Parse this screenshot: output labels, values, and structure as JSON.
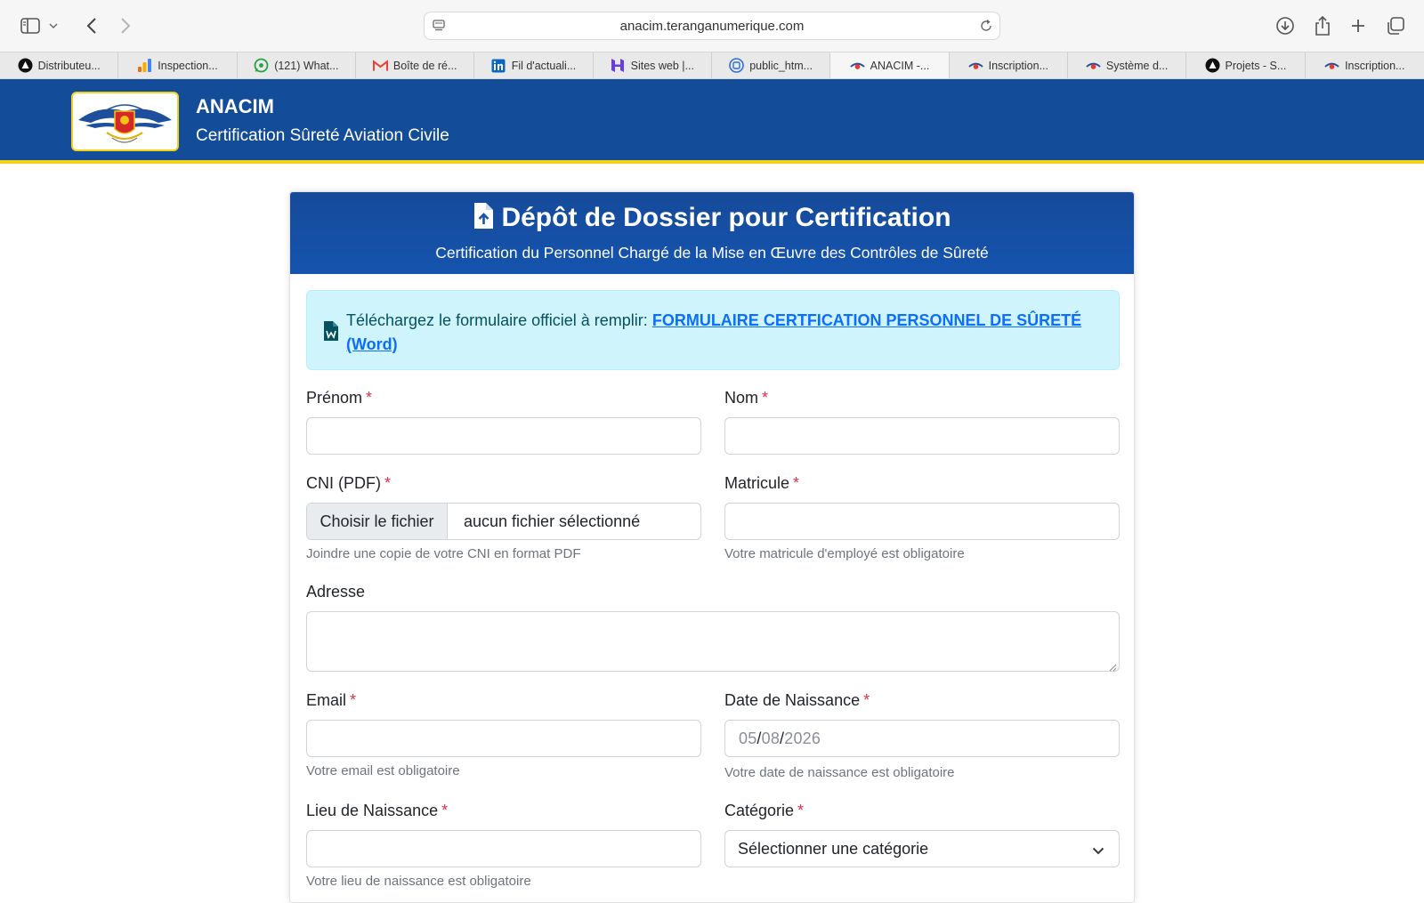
{
  "browser": {
    "url": "anacim.teranganumerique.com",
    "tabs": [
      {
        "label": "Distributeu...",
        "icon": "triangle-logo-icon"
      },
      {
        "label": "Inspection...",
        "icon": "analytics-icon"
      },
      {
        "label": "(121) What...",
        "icon": "whatsapp-icon"
      },
      {
        "label": "Boîte de ré...",
        "icon": "gmail-icon"
      },
      {
        "label": "Fil d'actuali...",
        "icon": "linkedin-icon"
      },
      {
        "label": "Sites web |...",
        "icon": "hostinger-icon"
      },
      {
        "label": "public_htm...",
        "icon": "cpanel-icon"
      },
      {
        "label": "ANACIM -...",
        "icon": "anacim-icon",
        "active": true
      },
      {
        "label": "Inscription...",
        "icon": "anacim-icon"
      },
      {
        "label": "Système d...",
        "icon": "anacim-icon"
      },
      {
        "label": "Projets - S...",
        "icon": "triangle-logo-icon"
      },
      {
        "label": "Inscription...",
        "icon": "anacim-icon"
      }
    ]
  },
  "header": {
    "brand": "ANACIM",
    "subtitle": "Certification Sûreté Aviation Civile",
    "logo_text": "ANACIM",
    "colors": {
      "primary": "#134c98",
      "accent": "#f3d31a"
    }
  },
  "card": {
    "title": "Dépôt de Dossier pour Certification",
    "subtitle": "Certification du Personnel Chargé de la Mise en Œuvre des Contrôles de Sûreté"
  },
  "alert": {
    "text": "Téléchargez le formulaire officiel à remplir:",
    "link": "FORMULAIRE CERTFICATION PERSONNEL DE SÛRETÉ (Word)"
  },
  "form": {
    "required_mark": "*",
    "prenom": {
      "label": "Prénom",
      "value": ""
    },
    "nom": {
      "label": "Nom",
      "value": ""
    },
    "cni": {
      "label": "CNI (PDF)",
      "button": "Choisir le fichier",
      "file": "aucun fichier sélectionné",
      "help": "Joindre une copie de votre CNI en format PDF"
    },
    "matricule": {
      "label": "Matricule",
      "value": "",
      "help": "Votre matricule d'employé est obligatoire"
    },
    "adresse": {
      "label": "Adresse",
      "value": ""
    },
    "email": {
      "label": "Email",
      "value": "",
      "help": "Votre email est obligatoire"
    },
    "naissance": {
      "label": "Date de Naissance",
      "day": "05",
      "month": "08",
      "year": "2026",
      "separator": "/",
      "help": "Votre date de naissance est obligatoire"
    },
    "lieu": {
      "label": "Lieu de Naissance",
      "value": "",
      "help": "Votre lieu de naissance est obligatoire"
    },
    "categorie": {
      "label": "Catégorie",
      "selected": "Sélectionner une catégorie"
    }
  }
}
